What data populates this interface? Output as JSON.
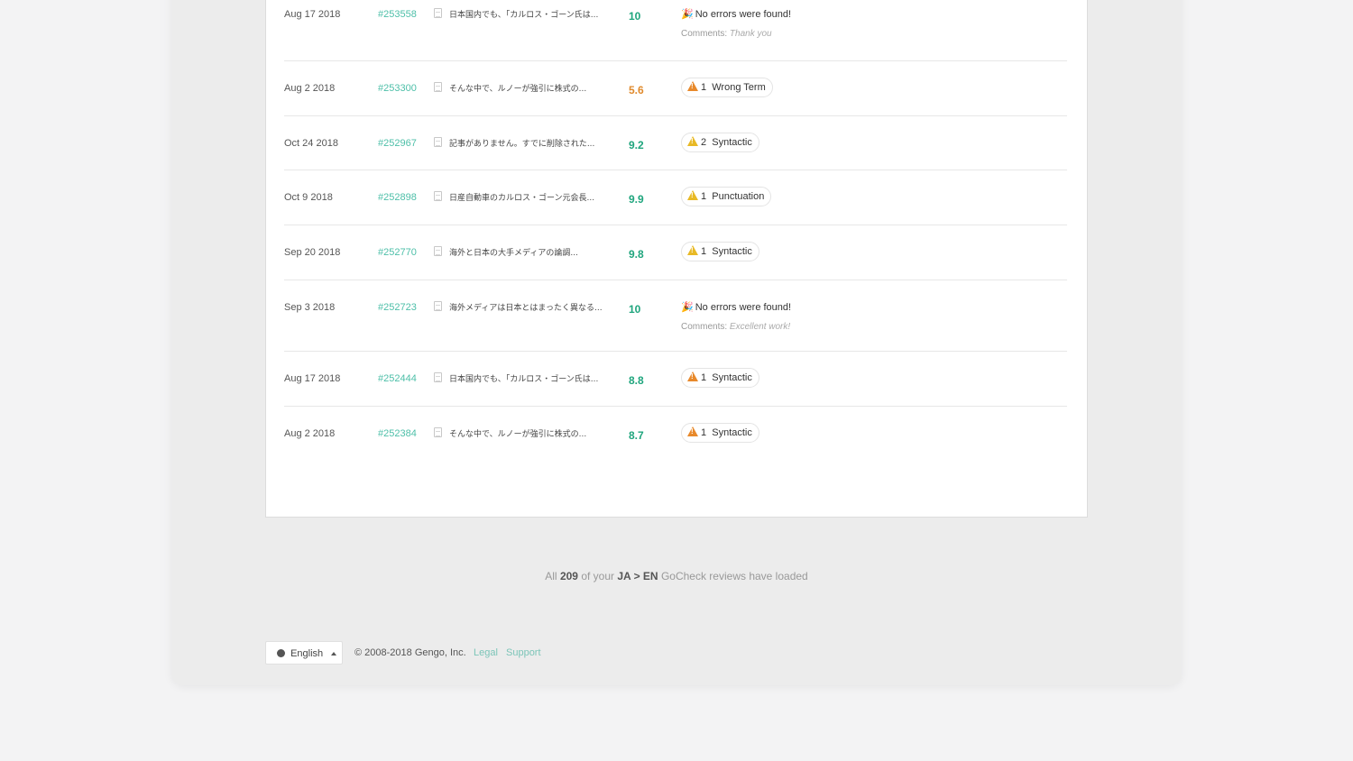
{
  "colors": {
    "score_green": "#1fa57d",
    "score_orange": "#e08a2c",
    "link": "#4dbfa8",
    "warn_orange": "#e8892b",
    "warn_yellow": "#e8b925"
  },
  "reviews": [
    {
      "date": "Aug 17 2018",
      "job": "#253558",
      "doc": "日本国内でも、「カルロス・ゴーン氏は...",
      "score": "10",
      "score_level": "good",
      "kind": "noerror",
      "noerror_text": "No errors were found!",
      "comment_label": "Comments:",
      "comment": "Thank you"
    },
    {
      "date": "Aug 2 2018",
      "job": "#253300",
      "doc": "そんな中で、ルノーが強引に株式の...",
      "score": "5.6",
      "score_level": "low",
      "kind": "badge",
      "badge_count": "1",
      "badge_text": "Wrong Term",
      "warn": "orange"
    },
    {
      "date": "Oct 24 2018",
      "job": "#252967",
      "doc": "記事がありません。すでに削除された...",
      "score": "9.2",
      "score_level": "good",
      "kind": "badge",
      "badge_count": "2",
      "badge_text": "Syntactic",
      "warn": "yellow"
    },
    {
      "date": "Oct 9 2018",
      "job": "#252898",
      "doc": "日産自動車のカルロス・ゴーン元会長...",
      "score": "9.9",
      "score_level": "good",
      "kind": "badge",
      "badge_count": "1",
      "badge_text": "Punctuation",
      "warn": "yellow"
    },
    {
      "date": "Sep 20 2018",
      "job": "#252770",
      "doc": "海外と日本の大手メディアの論調...",
      "score": "9.8",
      "score_level": "good",
      "kind": "badge",
      "badge_count": "1",
      "badge_text": "Syntactic",
      "warn": "yellow"
    },
    {
      "date": "Sep 3 2018",
      "job": "#252723",
      "doc": "海外メディアは日本とはまったく異なる...",
      "score": "10",
      "score_level": "good",
      "kind": "noerror",
      "noerror_text": "No errors were found!",
      "comment_label": "Comments:",
      "comment": "Excellent work!"
    },
    {
      "date": "Aug 17 2018",
      "job": "#252444",
      "doc": "日本国内でも、「カルロス・ゴーン氏は...",
      "score": "8.8",
      "score_level": "good",
      "kind": "badge",
      "badge_count": "1",
      "badge_text": "Syntactic",
      "warn": "orange"
    },
    {
      "date": "Aug 2 2018",
      "job": "#252384",
      "doc": "そんな中で、ルノーが強引に株式の...",
      "score": "8.7",
      "score_level": "good",
      "kind": "badge",
      "badge_count": "1",
      "badge_text": "Syntactic",
      "warn": "orange"
    }
  ],
  "summary": {
    "prefix": "All",
    "count": "209",
    "mid": "of your",
    "pair": "JA > EN",
    "suffix": "GoCheck reviews have loaded"
  },
  "footer": {
    "language": "English",
    "copyright": "© 2008-2018 Gengo, Inc.",
    "legal": "Legal",
    "support": "Support"
  }
}
